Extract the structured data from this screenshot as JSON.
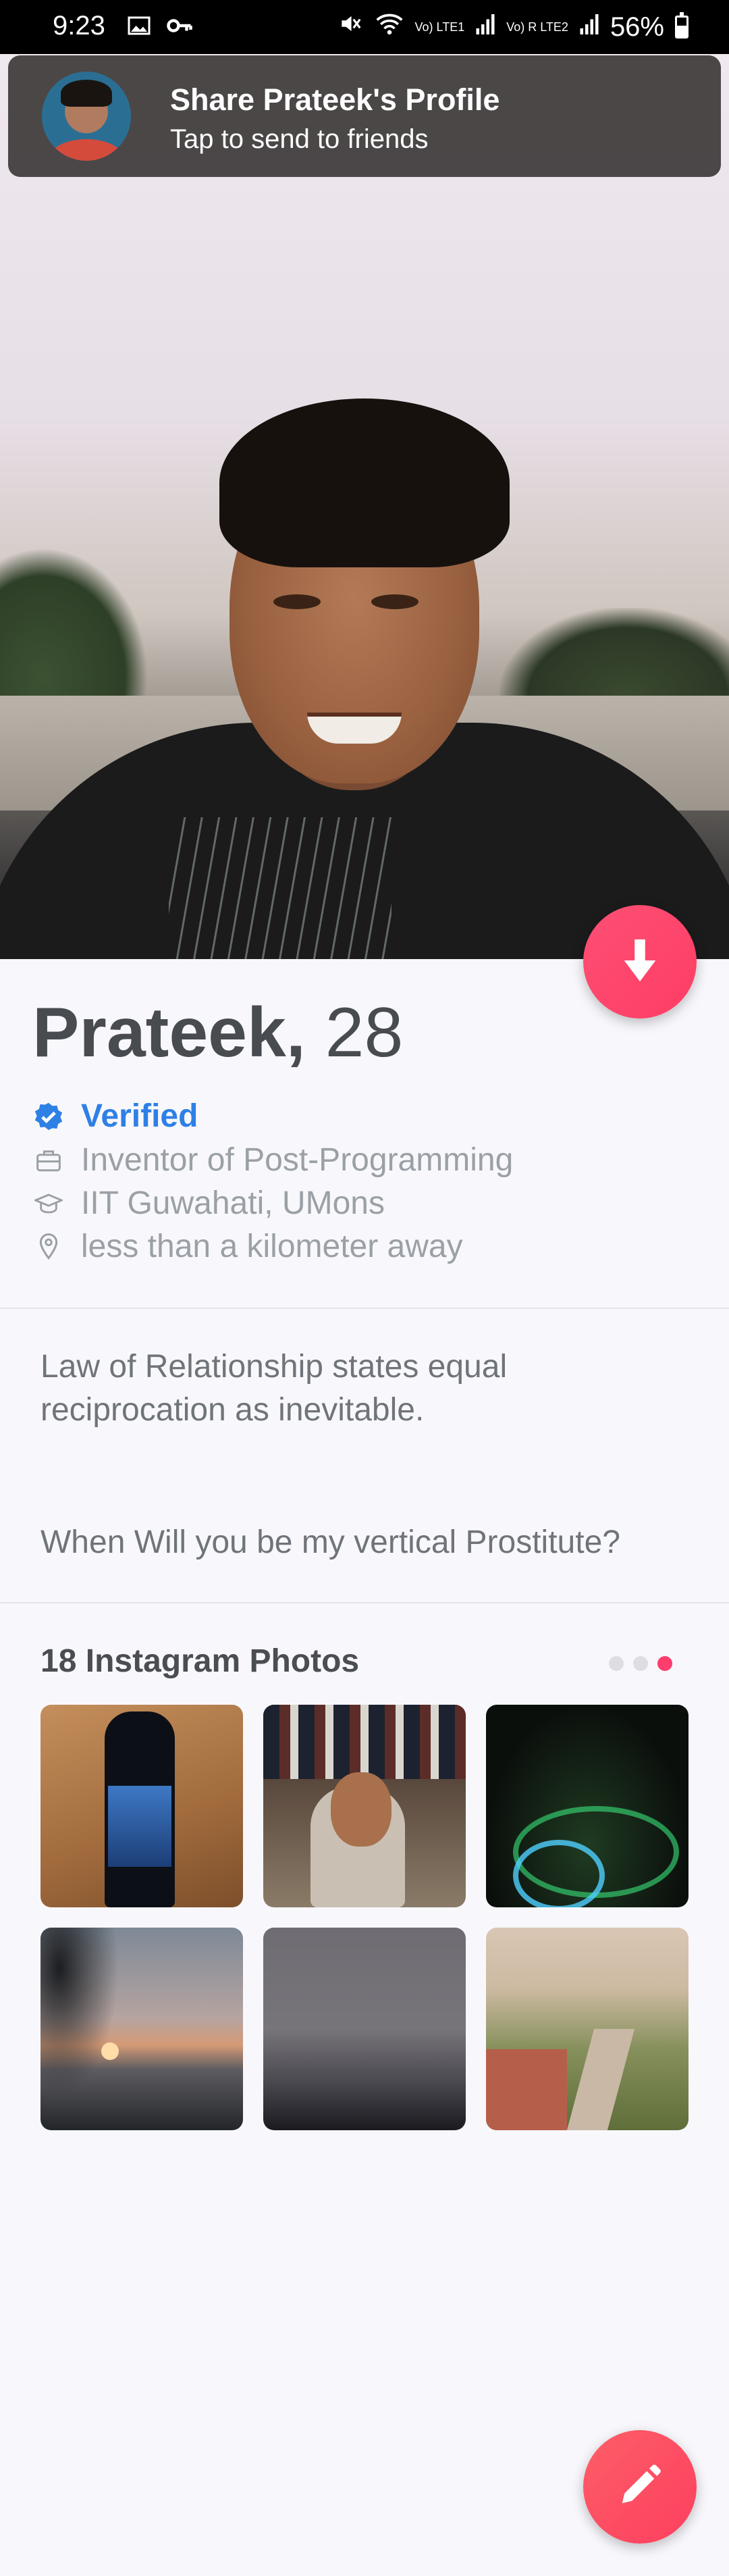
{
  "status_bar": {
    "time": "9:23",
    "network_1": "Vo) LTE1",
    "network_2": "Vo) R LTE2",
    "battery": "56%",
    "battery_level": 0.56
  },
  "share_banner": {
    "title": "Share Prateek's Profile",
    "subtitle": "Tap to send to friends"
  },
  "profile": {
    "name": "Prateek,",
    "age": "28",
    "verified_label": "Verified",
    "job": "Inventor of Post-Programming",
    "school": "IIT Guwahati, UMons",
    "distance": "less than a kilometer away"
  },
  "bio": {
    "line1": "Law of Relationship states equal reciprocation as inevitable.",
    "line2": "When Will you be my vertical Prostitute?"
  },
  "instagram": {
    "title": "18 Instagram Photos",
    "pages": 3,
    "active_page": 3
  },
  "colors": {
    "accent": "#fe3c6e",
    "verified": "#2f80e5"
  },
  "icons": {
    "down": "arrow-down-icon",
    "edit": "pencil-icon",
    "verified": "verified-badge-icon",
    "job": "briefcase-icon",
    "school": "graduation-cap-icon",
    "distance": "location-pin-icon"
  }
}
